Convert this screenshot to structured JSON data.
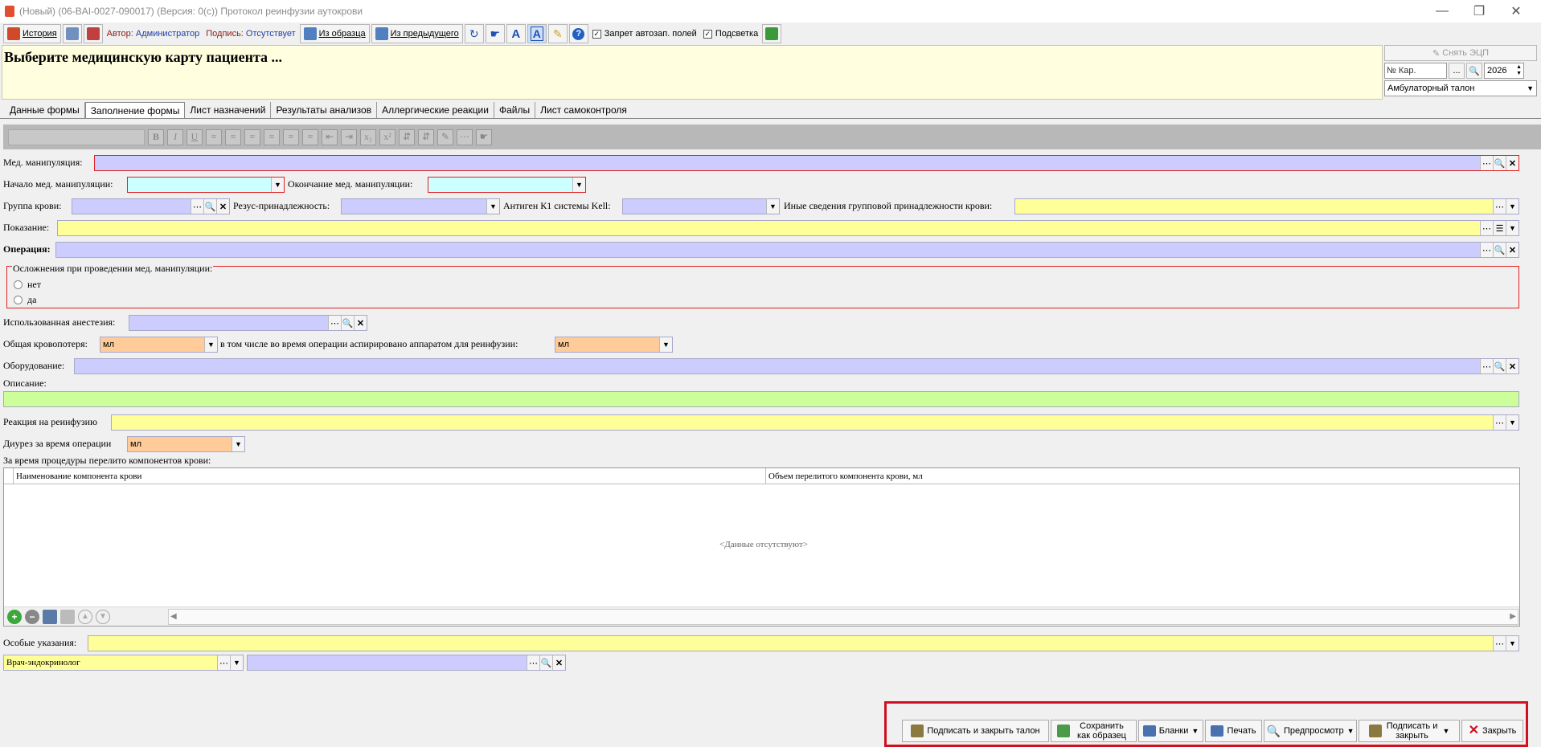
{
  "window": {
    "title": "(Новый) (06-BAI-0027-090017) (Версия: 0(с)) Протокол реинфузии аутокрови"
  },
  "toolbar": {
    "history": "История",
    "author_label": "Автор:",
    "author_value": "Администратор",
    "sign_label": "Подпись:",
    "sign_value": "Отсутствует",
    "from_sample": "Из образца",
    "from_previous": "Из предыдущего",
    "autofill_ban": "Запрет автозап. полей",
    "highlight": "Подсветка"
  },
  "header": {
    "title": "Выберите медицинскую карту пациента ..."
  },
  "right_panel": {
    "remove_ecp": "Снять ЭЦП",
    "card_placeholder": "№ Кар.",
    "dots": "...",
    "year": "2026",
    "ticket_type": "Амбулаторный талон"
  },
  "tabs": [
    "Данные формы",
    "Заполнение формы",
    "Лист назначений",
    "Результаты анализов",
    "Аллергические реакции",
    "Файлы",
    "Лист самоконтроля"
  ],
  "fields": {
    "med_manip": "Мед. манипуляция:",
    "start": "Начало мед. манипуляции:",
    "end": "Окончание мед. манипуляции:",
    "blood_group": "Группа крови:",
    "rh": "Резус-принадлежность:",
    "kell": "Антиген К1 системы Kell:",
    "other_group": "Иные сведения групповой принадлежности крови:",
    "indication": "Показание:",
    "operation": "Операция:",
    "complications": "Осложнения при проведении мед. манипуляции:",
    "no": "нет",
    "yes": "да",
    "anesthesia": "Использованная анестезия:",
    "blood_loss": "Общая кровопотеря:",
    "unit_ml": "мл",
    "aspirated": "в том числе во время операции аспирировано аппаратом для реинфузии:",
    "equipment": "Оборудование:",
    "description": "Описание:",
    "reaction": "Реакция на реинфузию",
    "diuresis": "Диурез за время операции",
    "transfused": "За время процедуры перелито компонентов крови:",
    "special": "Особые указания:",
    "doctor": "Врач-эндокринолог"
  },
  "table": {
    "col1": "Наименование компонента крови",
    "col2": "Объем перелитого компонента крови, мл",
    "empty": "<Данные отсутствуют>"
  },
  "bottom": {
    "sign_close_ticket": "Подписать и закрыть талон",
    "save_sample": "Сохранить как образец",
    "forms": "Бланки",
    "print": "Печать",
    "preview": "Предпросмотр",
    "sign_close": "Подписать и закрыть",
    "close": "Закрыть"
  },
  "colors": {
    "accent_red": "#e02020",
    "lavender": "#ccccff",
    "yellow": "#ffff99",
    "orange": "#ffcc99",
    "green": "#ccff99"
  }
}
